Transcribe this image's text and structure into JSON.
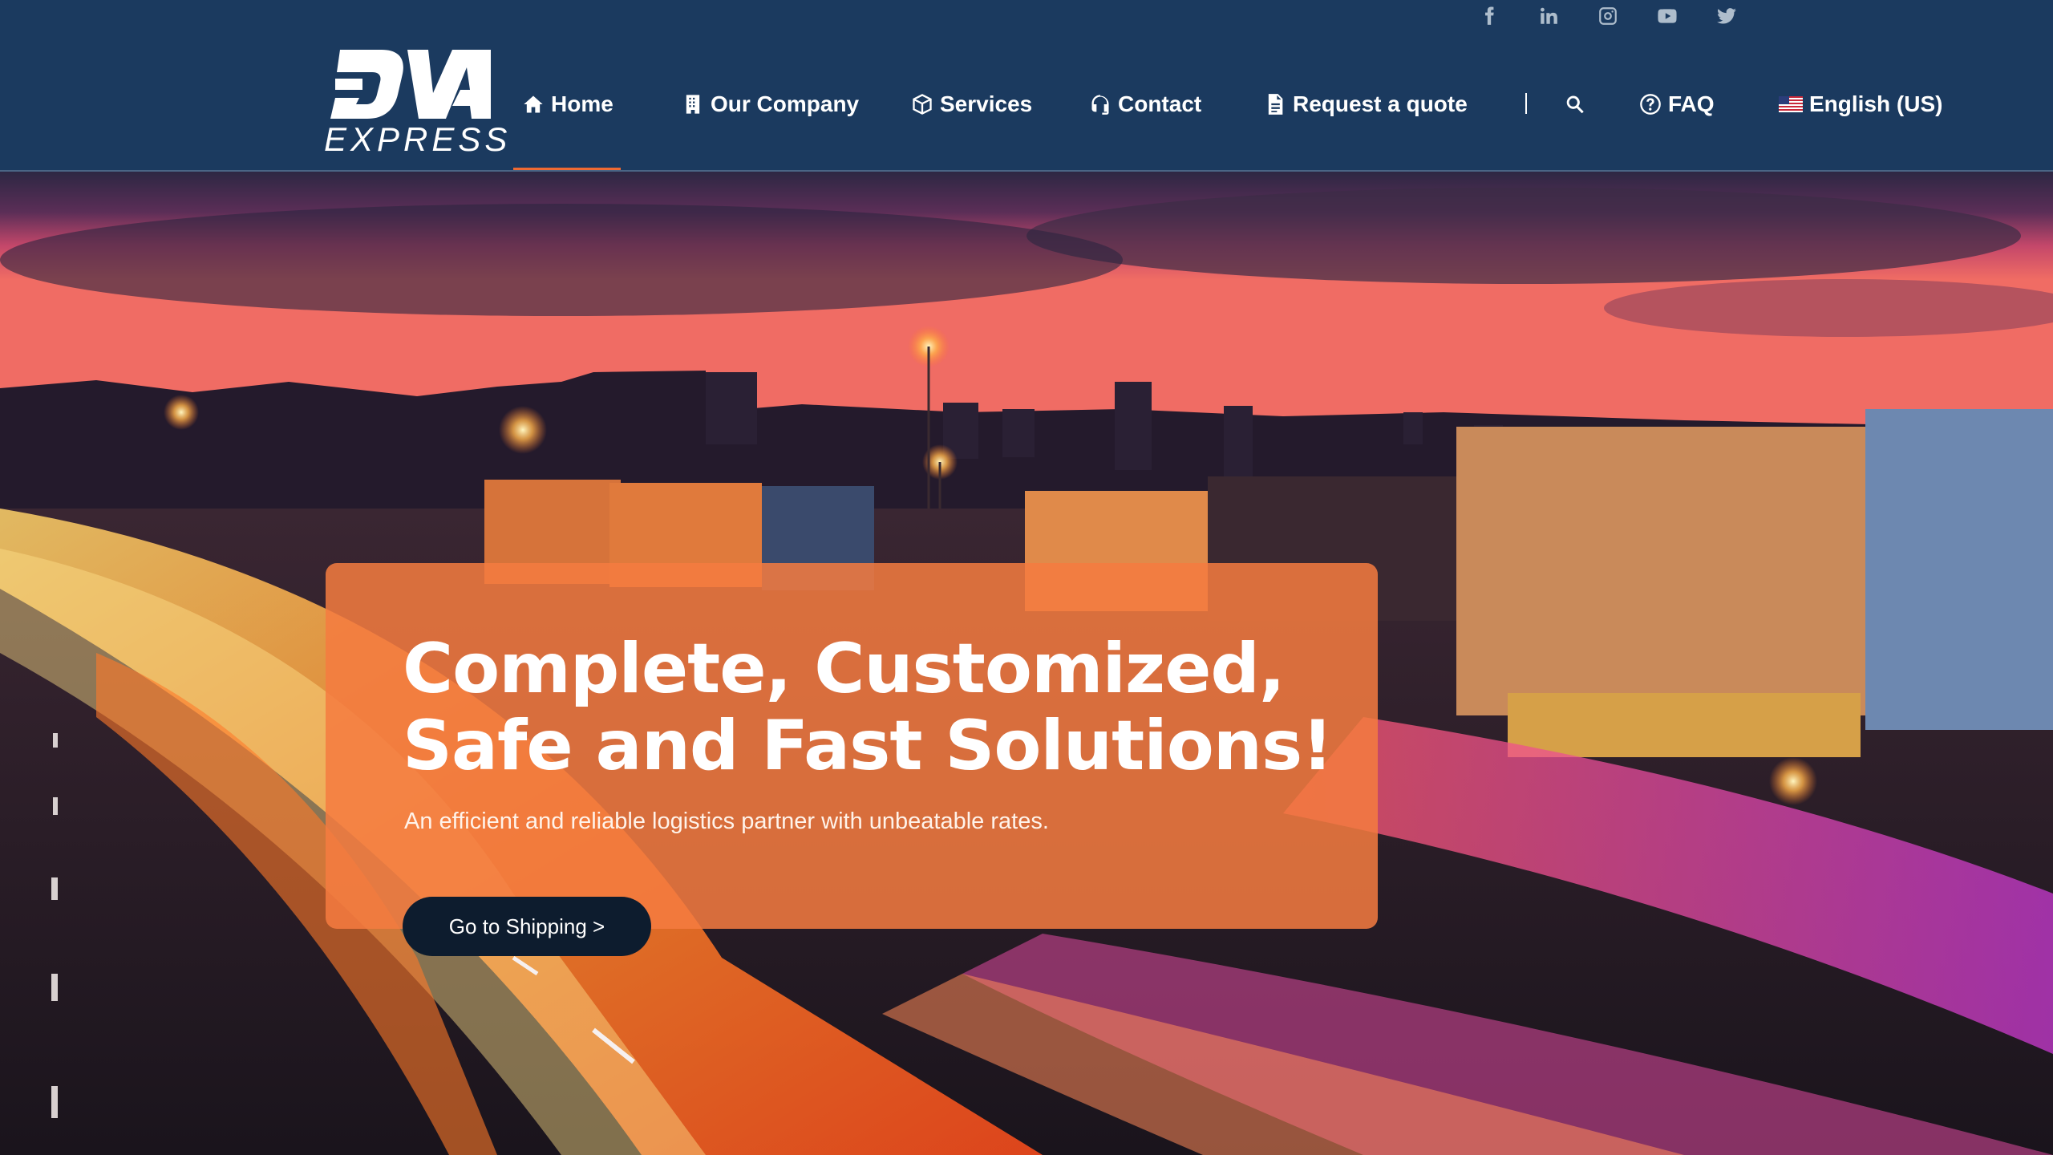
{
  "brand": {
    "logo_text": "DVA",
    "logo_sub": "EXPRESS"
  },
  "social": [
    {
      "name": "facebook",
      "icon": "facebook-icon"
    },
    {
      "name": "linkedin",
      "icon": "linkedin-icon"
    },
    {
      "name": "instagram",
      "icon": "instagram-icon"
    },
    {
      "name": "youtube",
      "icon": "youtube-icon"
    },
    {
      "name": "twitter",
      "icon": "twitter-icon"
    }
  ],
  "nav": {
    "items": [
      {
        "label": "Home",
        "icon": "home-icon",
        "active": true
      },
      {
        "label": "Our Company",
        "icon": "building-icon"
      },
      {
        "label": "Services",
        "icon": "box-icon"
      },
      {
        "label": "Contact",
        "icon": "headset-icon"
      },
      {
        "label": "Request a quote",
        "icon": "document-icon"
      }
    ],
    "search_icon": "search-icon",
    "faq_label": "FAQ",
    "faq_icon": "question-circle-icon",
    "language_label": "English (US)",
    "language_icon": "us-flag-icon"
  },
  "hero": {
    "title": "Complete, Customized, Safe and Fast Solutions!",
    "subtitle": "An efficient and reliable logistics partner with unbeatable rates.",
    "cta_label": "Go to Shipping >"
  },
  "colors": {
    "header_bg": "#1b3a5f",
    "accent": "#ef6a33",
    "card": "#f47c40",
    "cta_bg": "#0d1c2e"
  }
}
